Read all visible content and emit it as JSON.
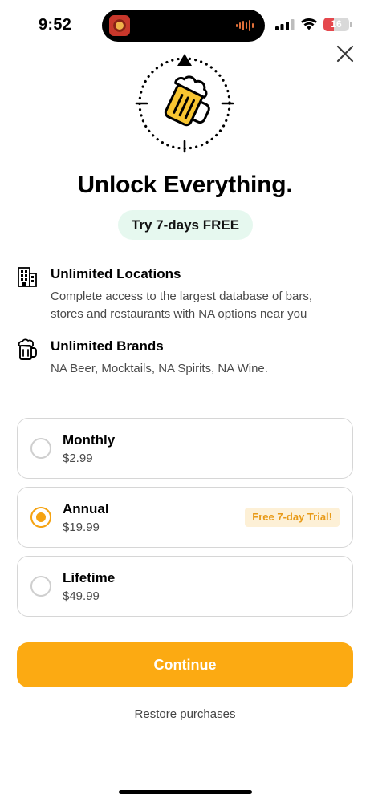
{
  "status_bar": {
    "time": "9:52",
    "battery_level": "16",
    "icons": [
      "signal-icon",
      "wifi-icon",
      "battery-icon"
    ]
  },
  "hero": {
    "icon": "beer-mug-compass-icon",
    "headline": "Unlock Everything.",
    "trial_pill": "Try 7-days FREE"
  },
  "features": [
    {
      "icon": "building-icon",
      "title": "Unlimited Locations",
      "description": "Complete access to the largest database of bars, stores and restaurants with NA options near you"
    },
    {
      "icon": "beer-mug-icon",
      "title": "Unlimited Brands",
      "description": "NA Beer, Mocktails, NA Spirits, NA Wine."
    }
  ],
  "plans": [
    {
      "name": "Monthly",
      "price": "$2.99",
      "selected": false,
      "badge": ""
    },
    {
      "name": "Annual",
      "price": "$19.99",
      "selected": true,
      "badge": "Free 7-day Trial!"
    },
    {
      "name": "Lifetime",
      "price": "$49.99",
      "selected": false,
      "badge": ""
    }
  ],
  "actions": {
    "continue_label": "Continue",
    "restore_label": "Restore purchases"
  },
  "colors": {
    "accent": "#fcaa12",
    "radio_selected": "#f5a312",
    "badge_bg": "#fdf0d6",
    "badge_text": "#e89a18",
    "pill_bg": "#e6f8ef",
    "beer_yellow": "#f7c531"
  }
}
